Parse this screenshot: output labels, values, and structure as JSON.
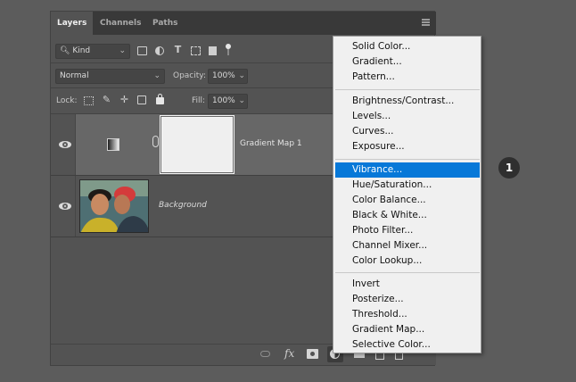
{
  "panel": {
    "tabs": [
      "Layers",
      "Channels",
      "Paths"
    ],
    "kind_label": "Kind",
    "blend_mode": "Normal",
    "opacity_label": "Opacity:",
    "opacity_value": "100%",
    "lock_label": "Lock:",
    "fill_label": "Fill:",
    "fill_value": "100%",
    "layers": [
      {
        "name": "Gradient Map 1"
      },
      {
        "name": "Background"
      }
    ]
  },
  "menu": {
    "groups": [
      [
        "Solid Color...",
        "Gradient...",
        "Pattern..."
      ],
      [
        "Brightness/Contrast...",
        "Levels...",
        "Curves...",
        "Exposure..."
      ],
      [
        "Vibrance...",
        "Hue/Saturation...",
        "Color Balance...",
        "Black & White...",
        "Photo Filter...",
        "Channel Mixer...",
        "Color Lookup..."
      ],
      [
        "Invert",
        "Posterize...",
        "Threshold...",
        "Gradient Map...",
        "Selective Color..."
      ]
    ],
    "highlighted": "Vibrance..."
  },
  "badge": "1",
  "colors": {
    "highlight": "#0778d8",
    "panel_bg": "#535353",
    "page_bg": "#5c5c5c"
  }
}
